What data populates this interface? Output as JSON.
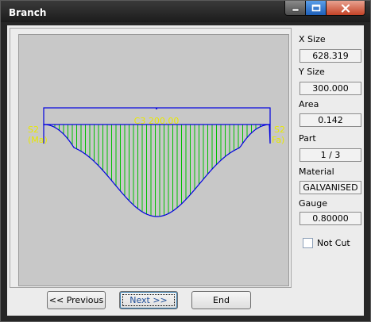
{
  "window": {
    "title": "Branch",
    "controls": {
      "minimize": "minimize-icon",
      "maximize": "maximize-icon",
      "close": "close-icon"
    }
  },
  "drawing": {
    "center_label": "C3 200.00",
    "left_top": "S2",
    "left_bottom": "(Ma)",
    "right_top": "S2",
    "right_bottom": "Fa)",
    "colors": {
      "background": "#c8c8c8",
      "outline": "#0000e0",
      "hatch": "#00c000",
      "labels": "#e8e800"
    }
  },
  "properties": {
    "x_size": {
      "label": "X Size",
      "value": "628.319"
    },
    "y_size": {
      "label": "Y Size",
      "value": "300.000"
    },
    "area": {
      "label": "Area",
      "value": "0.142"
    },
    "part": {
      "label": "Part",
      "value": "1 / 3"
    },
    "material": {
      "label": "Material",
      "value": "GALVANISED"
    },
    "gauge": {
      "label": "Gauge",
      "value": "0.80000"
    },
    "not_cut": {
      "label": "Not Cut",
      "checked": false
    }
  },
  "buttons": {
    "previous": "<< Previous",
    "next": "Next >>",
    "end": "End"
  }
}
